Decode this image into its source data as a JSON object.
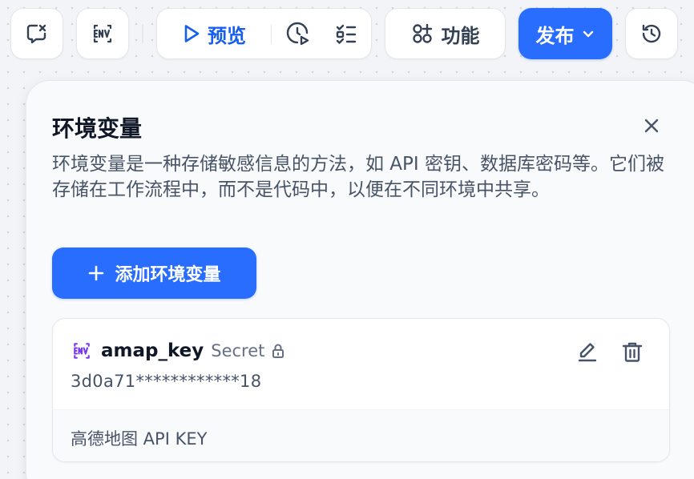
{
  "toolbar": {
    "preview_label": "预览",
    "feature_label": "功能",
    "publish_label": "发布",
    "icons": {
      "checklist": "chat-check-icon",
      "env": "env-icon",
      "preview": "play-icon",
      "run_history": "clock-play-icon",
      "checklist_list": "checklist-icon",
      "features": "apps-icon",
      "publish_dropdown": "chevron-down-icon",
      "history": "history-icon"
    },
    "colors": {
      "accent": "#296dff",
      "preview_text": "#155eef"
    }
  },
  "panel": {
    "title": "环境变量",
    "description": "环境变量是一种存储敏感信息的方法，如 API 密钥、数据库密码等。它们被存储在工作流程中，而不是代码中，以便在不同环境中共享。",
    "add_button_label": "添加环境变量",
    "close_icon": "close-icon"
  },
  "variables": [
    {
      "name": "amap_key",
      "type": "Secret",
      "value": "3d0a71************18",
      "description": "高德地图 API KEY",
      "icon": "env-icon",
      "badge_color": "#7839ee"
    }
  ]
}
